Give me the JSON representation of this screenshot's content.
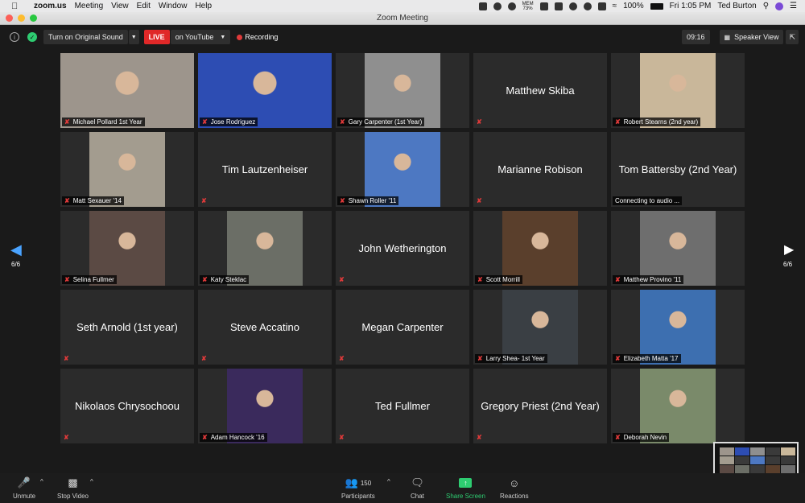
{
  "menubar": {
    "app": "zoom.us",
    "items": [
      "Meeting",
      "View",
      "Edit",
      "Window",
      "Help"
    ],
    "mem_label": "MEM",
    "mem_value": "73%",
    "battery": "100%",
    "clock": "Fri 1:05 PM",
    "user": "Ted Burton"
  },
  "window": {
    "title": "Zoom Meeting"
  },
  "topbar": {
    "original_sound": "Turn on Original Sound",
    "live": "LIVE",
    "live_target": "on YouTube",
    "recording": "Recording",
    "timer": "09:16",
    "view": "Speaker View"
  },
  "tiles": [
    {
      "name": "Michael Pollard 1st Year",
      "photo": true,
      "bg": "#9d958c"
    },
    {
      "name": "Jose Rodriguez",
      "photo": true,
      "bg": "#2d4db3"
    },
    {
      "name": "Gary Carpenter (1st Year)",
      "photo": true,
      "bg": "#8f8f8f"
    },
    {
      "name": "Matthew Skiba",
      "photo": false
    },
    {
      "name": "Robert Stearns (2nd year)",
      "photo": true,
      "bg": "#c9b79a"
    },
    {
      "name": "Matt Sexauer '14",
      "photo": true,
      "bg": "#a39c8f"
    },
    {
      "name": "Tim Lautzenheiser",
      "photo": false
    },
    {
      "name": "Shawn Roller '11",
      "photo": true,
      "bg": "#4d78c2"
    },
    {
      "name": "Marianne Robison",
      "photo": false
    },
    {
      "name": "Tom Battersby (2nd Year)",
      "photo": false,
      "status": "Connecting to audio ..."
    },
    {
      "name": "Selina Fullmer",
      "photo": true,
      "bg": "#5b4a44"
    },
    {
      "name": "Katy Steklac",
      "photo": true,
      "bg": "#6b6e66"
    },
    {
      "name": "John Wetherington",
      "photo": false
    },
    {
      "name": "Scott Morrill",
      "photo": true,
      "bg": "#5a3f2c"
    },
    {
      "name": "Matthew Provino '11",
      "photo": true,
      "bg": "#6e6e6e"
    },
    {
      "name": "Seth Arnold (1st year)",
      "photo": false
    },
    {
      "name": "Steve Accatino",
      "photo": false
    },
    {
      "name": "Megan Carpenter",
      "photo": false
    },
    {
      "name": "Larry Shea- 1st Year",
      "photo": true,
      "bg": "#3a3f44"
    },
    {
      "name": "Elizabeth Matta '17",
      "photo": true,
      "bg": "#3d6fb0"
    },
    {
      "name": "Nikolaos Chrysochoou",
      "photo": false
    },
    {
      "name": "Adam Hancock '16",
      "photo": true,
      "bg": "#3a2a5c"
    },
    {
      "name": "Ted Fullmer",
      "photo": false
    },
    {
      "name": "Gregory Priest (2nd Year)",
      "photo": false
    },
    {
      "name": "Deborah Nevin",
      "photo": true,
      "bg": "#7a8a6a"
    }
  ],
  "pager": {
    "left": "6/6",
    "right": "6/6"
  },
  "toolbar": {
    "unmute": "Unmute",
    "stop_video": "Stop Video",
    "participants": "Participants",
    "participants_count": "150",
    "chat": "Chat",
    "share_screen": "Share Screen",
    "reactions": "Reactions"
  },
  "colors": {
    "live": "#e02828",
    "share": "#2ecc71",
    "accent": "#4aa3ff"
  }
}
